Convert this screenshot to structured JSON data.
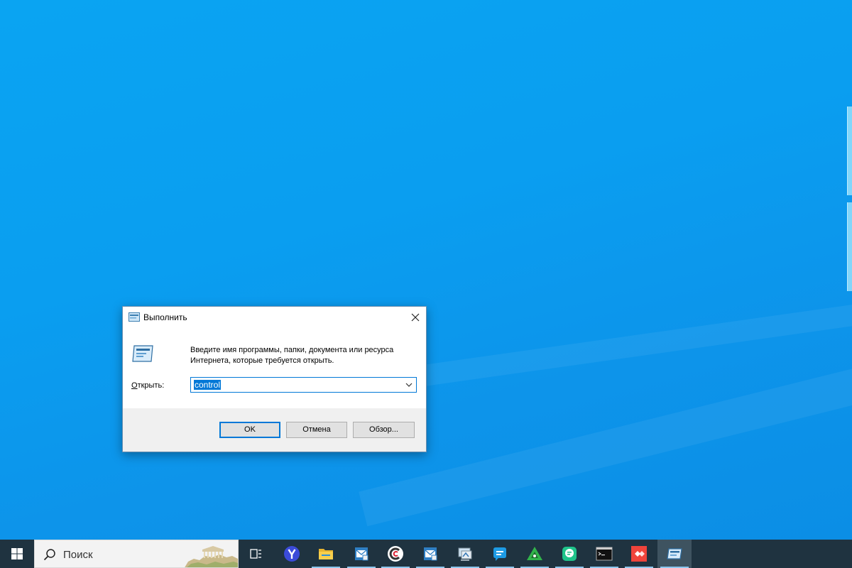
{
  "dialog": {
    "title": "Выполнить",
    "description": "Введите имя программы, папки, документа или ресурса Интернета, которые требуется открыть.",
    "open_label_accel": "О",
    "open_label_rest": "ткрыть:",
    "input_value": "control",
    "buttons": {
      "ok": "OK",
      "cancel": "Отмена",
      "browse": "Обзор..."
    }
  },
  "taskbar": {
    "search_placeholder": "Поиск",
    "apps": [
      {
        "name": "task-view",
        "icon": "task-view-icon",
        "running": false
      },
      {
        "name": "yandex-browser",
        "icon": "yandex-browser-icon",
        "running": false
      },
      {
        "name": "file-explorer",
        "icon": "folder-icon",
        "running": true
      },
      {
        "name": "mail-1",
        "icon": "mail-icon",
        "running": true
      },
      {
        "name": "ccleaner",
        "icon": "ccleaner-icon",
        "running": true
      },
      {
        "name": "mail-2",
        "icon": "mail-icon",
        "running": true
      },
      {
        "name": "remote-desktop",
        "icon": "remote-desktop-icon",
        "running": true
      },
      {
        "name": "messenger-1",
        "icon": "chat-bubble-icon",
        "running": true
      },
      {
        "name": "triangle-app",
        "icon": "green-triangle-icon",
        "running": true
      },
      {
        "name": "messenger-2",
        "icon": "green-chat-icon",
        "running": true
      },
      {
        "name": "terminal",
        "icon": "terminal-icon",
        "running": true
      },
      {
        "name": "anydesk",
        "icon": "anydesk-icon",
        "running": true
      },
      {
        "name": "run",
        "icon": "run-icon",
        "running": true,
        "active": true
      }
    ]
  },
  "colors": {
    "desktop": "#0a9ef0",
    "taskbar": "#1f3340",
    "accent": "#0078d7"
  }
}
